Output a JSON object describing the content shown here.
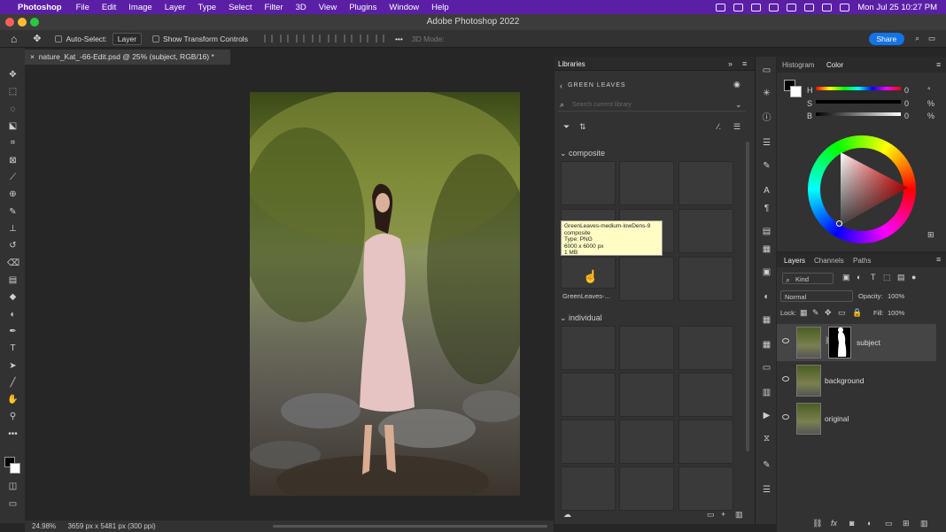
{
  "menubar": {
    "app": "Photoshop",
    "items": [
      "File",
      "Edit",
      "Image",
      "Layer",
      "Type",
      "Select",
      "Filter",
      "3D",
      "View",
      "Plugins",
      "Window",
      "Help"
    ],
    "clock": "Mon Jul 25  10:27 PM"
  },
  "window": {
    "title": "Adobe Photoshop 2022"
  },
  "options": {
    "auto_select_label": "Auto-Select:",
    "auto_select_value": "Layer",
    "transform_label": "Show Transform Controls",
    "mode3d": "3D Mode:",
    "share": "Share"
  },
  "document": {
    "tab": "nature_Kat_-66-Edit.psd @ 25% (subject, RGB/16) *",
    "zoom": "24.98%",
    "dimensions": "3659 px x 5481 px (300 ppi)"
  },
  "libraries": {
    "tab": "Libraries",
    "library_name": "GREEN LEAVES",
    "search_placeholder": "Search current library",
    "group_composite": "composite",
    "group_individual": "individual",
    "item_label": "GreenLeaves-...",
    "tooltip": [
      "GreenLeaves-medium-lowDens-9",
      "composite",
      "Type: PNG",
      "6000 x 6000 px",
      "1 MB"
    ]
  },
  "color": {
    "tabs": [
      "Histogram",
      "Color"
    ],
    "h_label": "H",
    "h_value": "0",
    "h_unit": "°",
    "s_label": "S",
    "s_value": "0",
    "s_unit": "%",
    "b_label": "B",
    "b_value": "0",
    "b_unit": "%"
  },
  "layers": {
    "tabs": [
      "Layers",
      "Channels",
      "Paths"
    ],
    "kind": "Kind",
    "blend": "Normal",
    "opacity_label": "Opacity:",
    "opacity_value": "100%",
    "lock_label": "Lock:",
    "fill_label": "Fill:",
    "fill_value": "100%",
    "rows": [
      "subject",
      "background",
      "original"
    ]
  },
  "colors": {
    "menubar": "#5b1fa6",
    "accent": "#1473e6",
    "panel": "#323232"
  }
}
